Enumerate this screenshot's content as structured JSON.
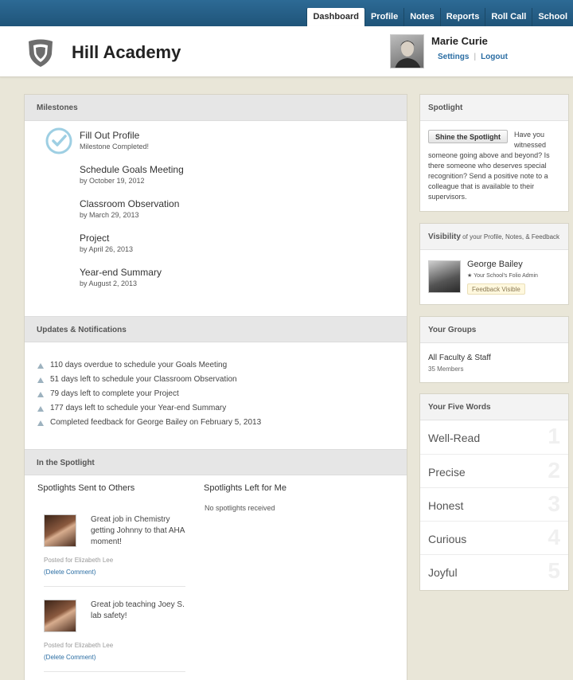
{
  "nav": {
    "tabs": [
      "Dashboard",
      "Profile",
      "Notes",
      "Reports",
      "Roll Call",
      "School"
    ],
    "active": "Dashboard"
  },
  "header": {
    "school_name": "Hill Academy",
    "user_name": "Marie Curie",
    "settings_link": "Settings",
    "separator": "|",
    "logout_link": "Logout"
  },
  "milestones": {
    "heading": "Milestones",
    "items": [
      {
        "title": "Fill Out Profile",
        "sub": "Milestone Completed!"
      },
      {
        "title": "Schedule Goals Meeting",
        "sub": "by October 19, 2012"
      },
      {
        "title": "Classroom Observation",
        "sub": "by March 29, 2013"
      },
      {
        "title": "Project",
        "sub": "by April 26, 2013"
      },
      {
        "title": "Year-end Summary",
        "sub": "by August 2, 2013"
      }
    ]
  },
  "updates": {
    "heading": "Updates & Notifications",
    "items": [
      "110 days overdue to schedule your Goals Meeting",
      "51 days left to schedule your Classroom Observation",
      "79 days left to complete your Project",
      "177 days left to schedule your Year-end Summary",
      "Completed feedback for George Bailey on February 5, 2013"
    ]
  },
  "in_spotlight": {
    "heading": "In the Spotlight",
    "sent_title": "Spotlights Sent to Others",
    "left_title": "Spotlights Left for Me",
    "none_text": "No spotlights received",
    "sent": [
      {
        "message": "Great job in Chemistry getting Johnny to that AHA moment!",
        "posted": "Posted for Elizabeth Lee",
        "delete": "(Delete Comment)"
      },
      {
        "message": "Great job teaching Joey S. lab safety!",
        "posted": "Posted for Elizabeth Lee",
        "delete": "(Delete Comment)"
      }
    ]
  },
  "spotlight_panel": {
    "heading": "Spotlight",
    "button": "Shine the Spotlight",
    "text": "Have you witnessed someone going above and beyond? Is there someone who deserves special recognition? Send a positive note to a colleague that is available to their supervisors."
  },
  "visibility_panel": {
    "heading": "Visibility",
    "heading_suffix": " of your Profile, Notes, & Feedback",
    "name": "George Bailey",
    "role": "★ Your School's Folio Admin",
    "badge": "Feedback Visible"
  },
  "groups_panel": {
    "heading": "Your Groups",
    "group_name": "All Faculty & Staff",
    "group_count": "35 Members"
  },
  "words_panel": {
    "heading": "Your Five Words",
    "words": [
      {
        "word": "Well-Read",
        "num": "1"
      },
      {
        "word": "Precise",
        "num": "2"
      },
      {
        "word": "Honest",
        "num": "3"
      },
      {
        "word": "Curious",
        "num": "4"
      },
      {
        "word": "Joyful",
        "num": "5"
      }
    ]
  },
  "colors": {
    "topbar": "#1f5479",
    "link": "#2a6da3",
    "background": "#e9e6d8",
    "check": "#9ecfe3"
  }
}
